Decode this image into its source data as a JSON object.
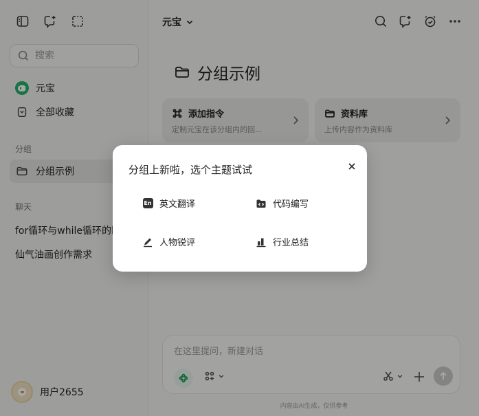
{
  "sidebar": {
    "search_placeholder": "搜索",
    "nav": [
      {
        "label": "元宝",
        "icon": "yuanbao-logo-icon"
      },
      {
        "label": "全部收藏",
        "icon": "bookmark-icon"
      }
    ],
    "group_section": "分组",
    "group_items": [
      {
        "label": "分组示例",
        "icon": "folder-icon"
      }
    ],
    "chat_section": "聊天",
    "chats": [
      {
        "label": "for循环与while循环的区"
      },
      {
        "label": "仙气油画创作需求"
      }
    ],
    "user": {
      "name": "用户2655"
    }
  },
  "header": {
    "model_name": "元宝"
  },
  "main": {
    "group_title": "分组示例",
    "cards": [
      {
        "title": "添加指令",
        "desc": "定制元宝在该分组内的回...",
        "icon": "command-icon"
      },
      {
        "title": "资料库",
        "desc": "上传内容作为资料库",
        "icon": "folder-icon"
      }
    ],
    "composer": {
      "placeholder": "在这里提问，新建对话"
    },
    "disclaimer": "内容由AI生成，仅供参考"
  },
  "modal": {
    "title": "分组上新啦，选个主题试试",
    "topics": [
      {
        "label": "英文翻译",
        "icon": "english-icon"
      },
      {
        "label": "代码编写",
        "icon": "code-icon"
      },
      {
        "label": "人物锐评",
        "icon": "pen-icon"
      },
      {
        "label": "行业总结",
        "icon": "bar-chart-icon"
      }
    ]
  },
  "colors": {
    "accent": "#24b36b",
    "overlay": "#000000"
  }
}
